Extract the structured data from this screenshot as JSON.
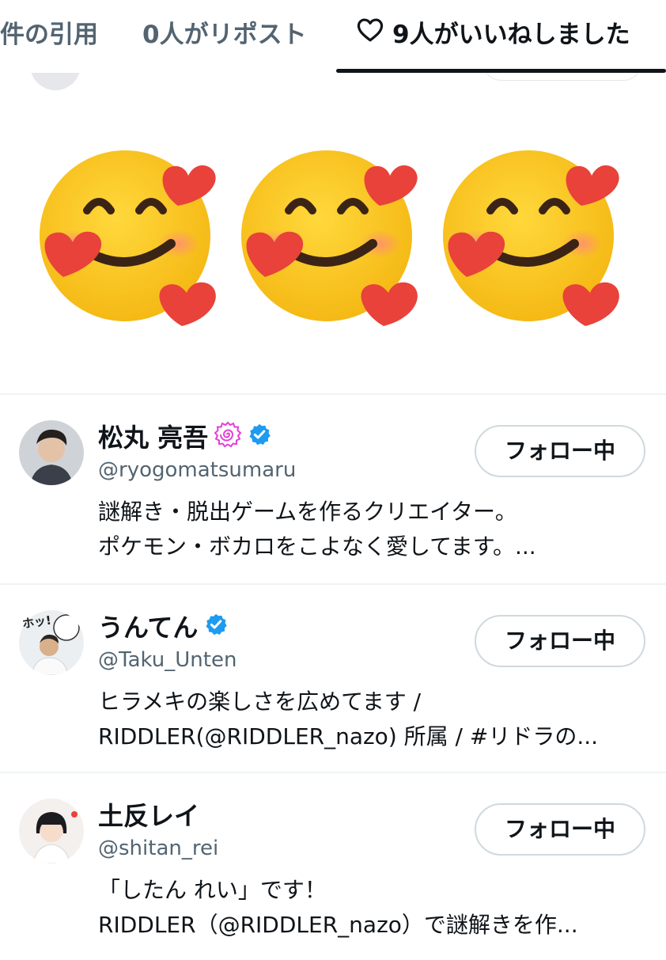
{
  "tabs": {
    "quotes": "件の引用",
    "reposts": "0人がリポスト",
    "likes": "9人がいいねしました"
  },
  "emoji_row": {
    "emoji_name": "smiling-face-with-hearts",
    "count": 3
  },
  "colors": {
    "text_primary": "#0f1419",
    "text_secondary": "#536471",
    "verified_blue": "#1d9bf0",
    "border": "#cfd9de",
    "naruto_pink": "#e43fd8",
    "heart_red": "#e8423a",
    "emoji_yellow": "#fbc531"
  },
  "users": [
    {
      "name": "松丸 亮吾",
      "handle": "@ryogomatsumaru",
      "follow_label": "フォロー中",
      "bio": [
        "謎解き・脱出ゲームを作るクリエイター。",
        "ポケモン・ボカロをこよなく愛してます。..."
      ],
      "badges": [
        "naruto-icon",
        "verified-icon"
      ]
    },
    {
      "name": "うんてん",
      "handle": "@Taku_Unten",
      "follow_label": "フォロー中",
      "bio": [
        "ヒラメキの楽しさを広めてます /",
        "RIDDLER(@RIDDLER_nazo) 所属 / #リドラの..."
      ],
      "badges": [
        "verified-icon"
      ],
      "avatar_text": "ホッ!"
    },
    {
      "name": "土反レイ",
      "handle": "@shitan_rei",
      "follow_label": "フォロー中",
      "bio": [
        "「したん れい」です！",
        "RIDDLER（@RIDDLER_nazo）で謎解きを作..."
      ],
      "badges": []
    }
  ]
}
